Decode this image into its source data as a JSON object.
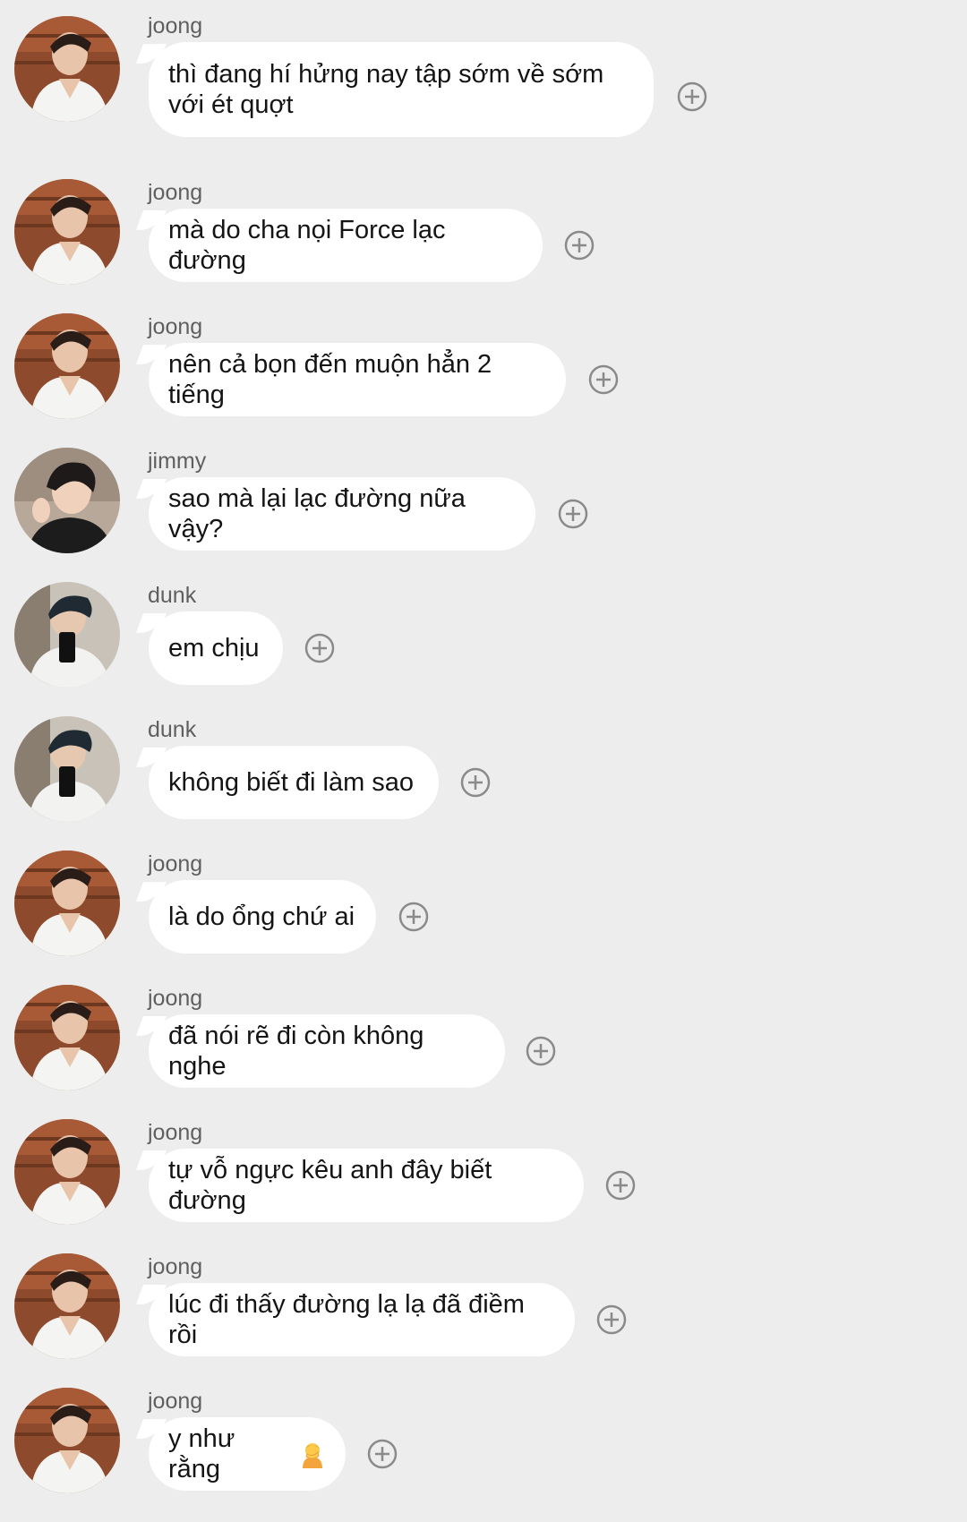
{
  "messages": [
    {
      "sender": "joong",
      "text": "thì đang hí hửng nay tập sớm về sớm với ét quợt",
      "avatar": "joong-avatar"
    },
    {
      "sender": "joong",
      "text": "mà do cha nọi Force lạc đường",
      "avatar": "joong-avatar"
    },
    {
      "sender": "joong",
      "text": "nên cả bọn đến muộn hẳn 2 tiếng",
      "avatar": "joong-avatar"
    },
    {
      "sender": "jimmy",
      "text": "sao mà lại lạc đường nữa vậy?",
      "avatar": "jimmy-avatar"
    },
    {
      "sender": "dunk",
      "text": "em chịu",
      "avatar": "dunk-avatar"
    },
    {
      "sender": "dunk",
      "text": "không biết đi làm sao",
      "avatar": "dunk-avatar"
    },
    {
      "sender": "joong",
      "text": "là do ổng chứ ai",
      "avatar": "joong-avatar"
    },
    {
      "sender": "joong",
      "text": "đã nói rẽ đi còn không nghe",
      "avatar": "joong-avatar"
    },
    {
      "sender": "joong",
      "text": "tự vỗ ngực kêu anh đây biết đường",
      "avatar": "joong-avatar"
    },
    {
      "sender": "joong",
      "text": "lúc đi thấy đường lạ lạ đã điềm rồi",
      "avatar": "joong-avatar"
    },
    {
      "sender": "joong",
      "text": "y như rằng",
      "avatar": "joong-avatar",
      "emoji": "person-facepalming-emoji"
    }
  ],
  "colors": {
    "background": "#ededed",
    "bubble": "#ffffff",
    "text": "#141414",
    "sender": "#5f5f5f",
    "icon": "#8a8a8a"
  },
  "icons": {
    "reaction": "add-reaction-icon"
  }
}
